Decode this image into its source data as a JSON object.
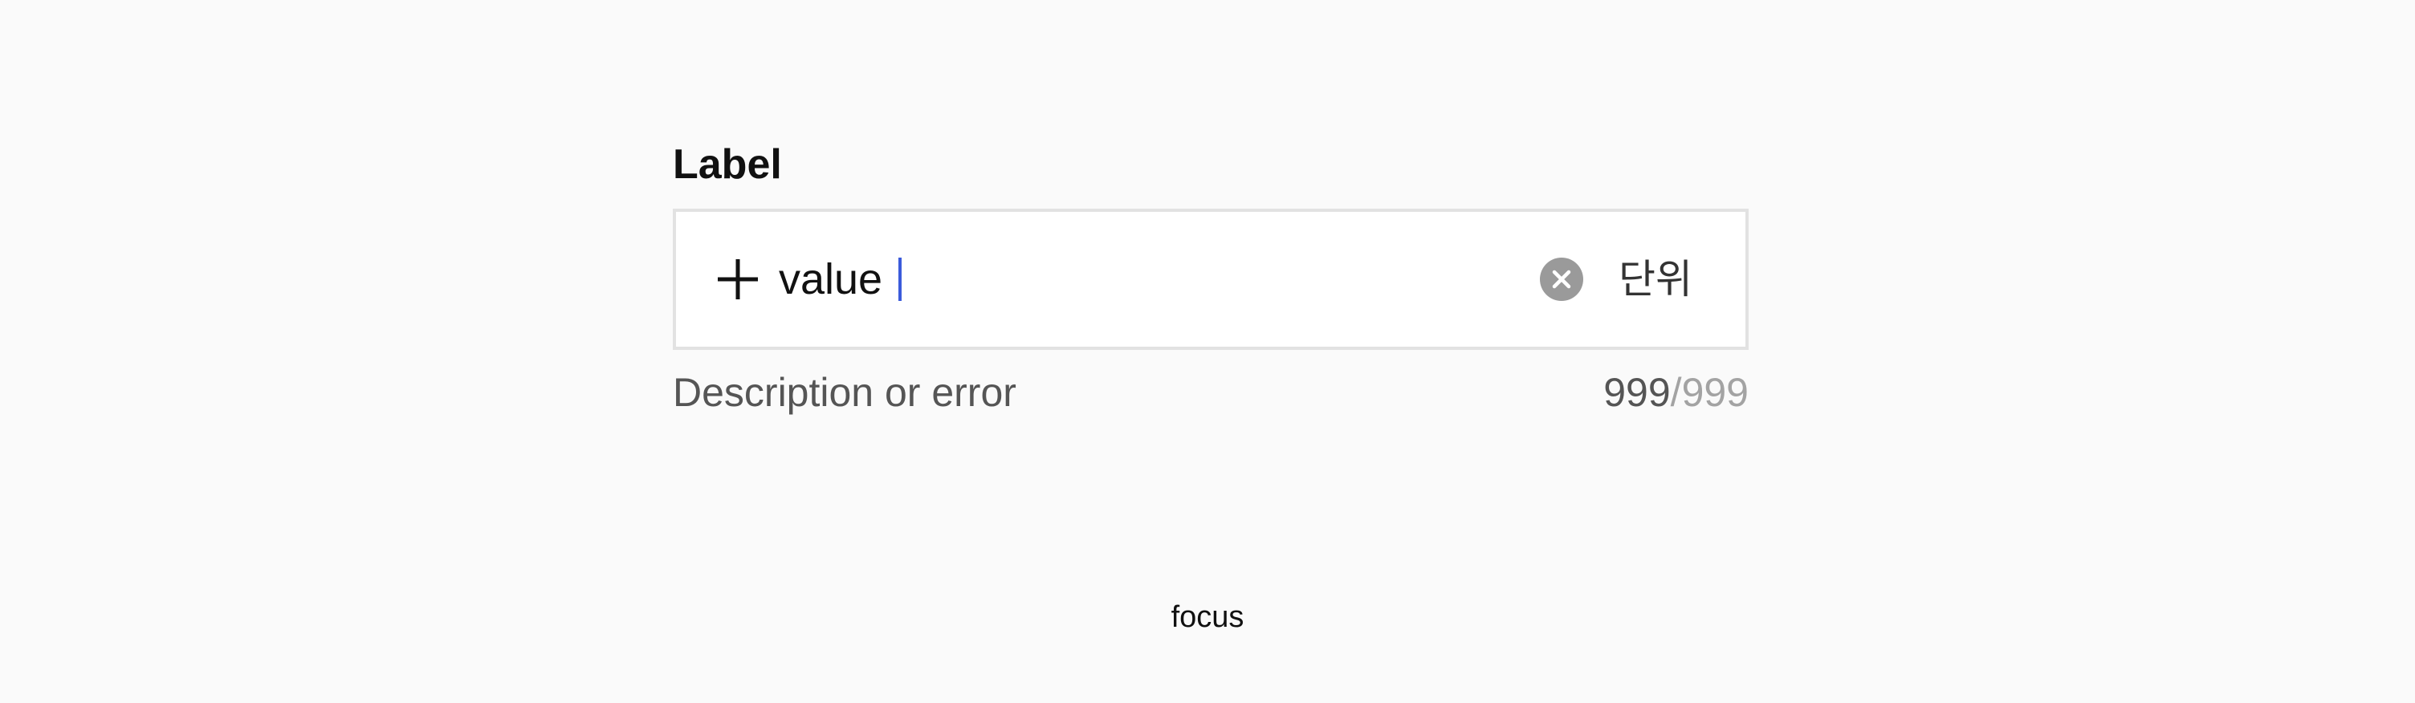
{
  "field": {
    "label": "Label",
    "value": "value",
    "unit": "단위",
    "description": "Description or error",
    "counter": {
      "current": "999",
      "separator": "/",
      "max": "999"
    },
    "prefix_icon": "plus-icon",
    "clear_icon": "clear-circle-icon"
  },
  "state_caption": "focus",
  "colors": {
    "background": "#fafafa",
    "input_background": "#ffffff",
    "input_border": "#e2e2e2",
    "caret": "#3b5bdb",
    "clear_icon": "#9a9a9a",
    "muted_text": "#a3a3a3"
  }
}
